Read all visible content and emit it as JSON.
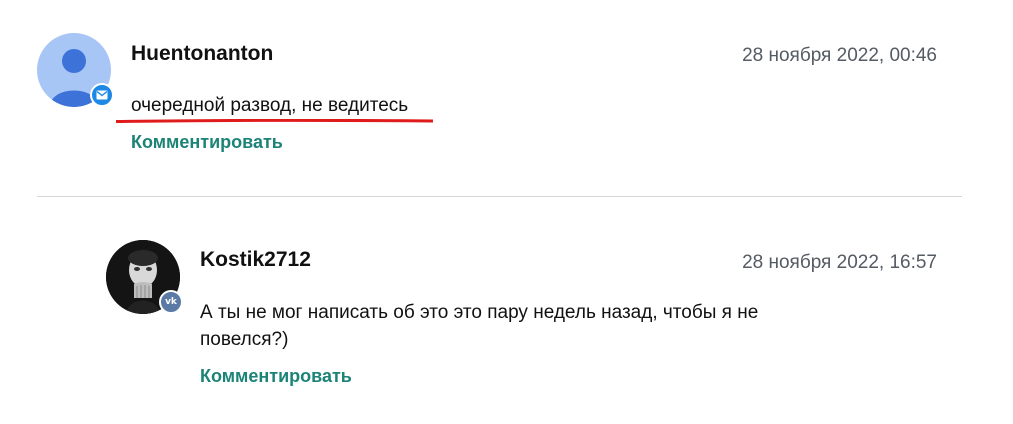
{
  "comments": [
    {
      "username": "Huentonanton",
      "date": "28 ноября 2022, 00:46",
      "text": "очередной развод, не ведитесь",
      "reply_label": "Комментировать",
      "avatar_icon": "default-user-avatar-icon",
      "badge_icon": "mail-icon",
      "badge_color": "#1e88e5",
      "text_highlight_color": "#e01b1b"
    },
    {
      "username": "Kostik2712",
      "date": "28 ноября 2022, 16:57",
      "text": "А ты не мог написать об это это пару недель назад, чтобы я не повелся?)",
      "reply_label": "Комментировать",
      "avatar_icon": "user-photo-avatar",
      "badge_icon": "vk-icon",
      "badge_color": "#5b7aa6"
    }
  ],
  "colors": {
    "link": "#1c8377",
    "date": "#555b63",
    "divider": "#d6d6d6"
  }
}
